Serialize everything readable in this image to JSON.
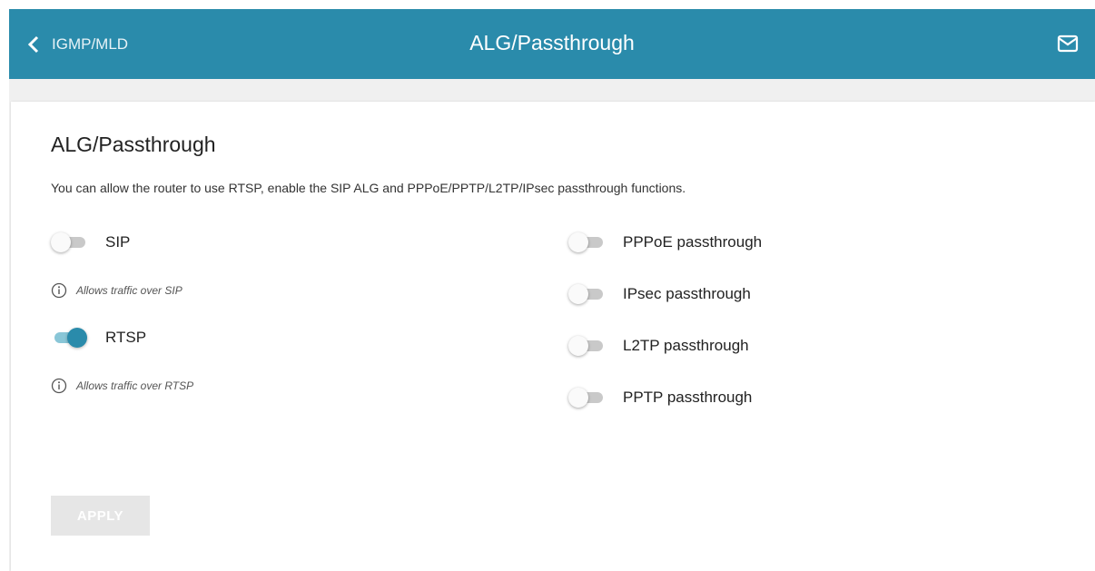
{
  "header": {
    "back_label": "IGMP/MLD",
    "title": "ALG/Passthrough",
    "back_icon": "chevron-left-icon",
    "mail_icon": "envelope-icon",
    "bg_color": "#2a8bab"
  },
  "section": {
    "title": "ALG/Passthrough",
    "description": "You can allow the router to use RTSP, enable the SIP ALG and PPPoE/PPTP/L2TP/IPsec passthrough functions."
  },
  "left_toggles": [
    {
      "label": "SIP",
      "enabled": false,
      "hint": "Allows traffic over SIP"
    },
    {
      "label": "RTSP",
      "enabled": true,
      "hint": "Allows traffic over RTSP"
    }
  ],
  "right_toggles": [
    {
      "label": "PPPoE passthrough",
      "enabled": false
    },
    {
      "label": "IPsec passthrough",
      "enabled": false
    },
    {
      "label": "L2TP passthrough",
      "enabled": false
    },
    {
      "label": "PPTP passthrough",
      "enabled": false
    }
  ],
  "apply_label": "APPLY",
  "colors": {
    "accent": "#2a8bab",
    "toggle_on_track": "#89c6d7",
    "toggle_off_track": "#c9c9c9"
  }
}
